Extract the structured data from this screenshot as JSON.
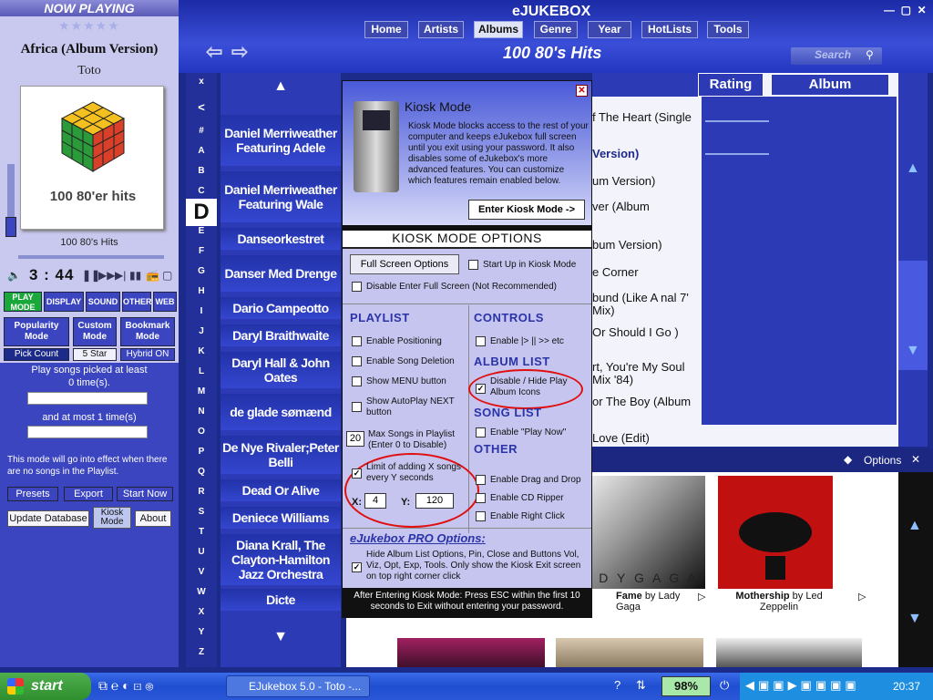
{
  "app": {
    "title": "eJUKEBOX",
    "page_title": "100 80's Hits",
    "search_placeholder": "Search"
  },
  "nav_tabs": [
    "Home",
    "Artists",
    "Albums",
    "Genre",
    "Year",
    "HotLists",
    "Tools"
  ],
  "now_playing": {
    "header": "NOW PLAYING",
    "title": "Africa (Album Version)",
    "artist": "Toto",
    "album": "100 80's Hits",
    "cover_text": "100 80'er hits",
    "time": "3 : 44"
  },
  "modes": {
    "row1": [
      "PLAY MODE",
      "DISPLAY",
      "SOUND",
      "OTHER",
      "WEB"
    ],
    "row2": [
      "Popularity Mode",
      "Custom Mode",
      "Bookmark Mode"
    ],
    "row3": [
      "Pick Count",
      "5 Star",
      "Hybrid ON"
    ]
  },
  "play_rules": {
    "line1": "Play songs picked at least",
    "line2": "0 time(s).",
    "line3": "and at most 1 time(s)",
    "note": "This mode will go into effect when there are no songs in the Playlist."
  },
  "left_buttons": {
    "presets": "Presets",
    "export": "Export",
    "start_now": "Start Now",
    "update_db": "Update Database",
    "kiosk": "Kiosk Mode",
    "about": "About"
  },
  "letters": [
    "x",
    "<",
    "#",
    "A",
    "B",
    "C",
    "D",
    "E",
    "F",
    "G",
    "H",
    "I",
    "J",
    "K",
    "L",
    "M",
    "N",
    "O",
    "P",
    "Q",
    "R",
    "S",
    "T",
    "U",
    "V",
    "W",
    "X",
    "Y",
    "Z"
  ],
  "artists": [
    "Daniel Merriweather Featuring Adele",
    "Daniel Merriweather Featuring Wale",
    "Danseorkestret",
    "Danser Med Drenge",
    "Dario Campeotto",
    "Daryl Braithwaite",
    "Daryl Hall & John Oates",
    "de glade sømænd",
    "De Nye Rivaler;Peter Belli",
    "Dead Or Alive",
    "Deniece Williams",
    "Diana Krall, The Clayton-Hamilton Jazz Orchestra",
    "Dicte"
  ],
  "columns": {
    "rating": "Rating",
    "album": "Album"
  },
  "songs": [
    "f The Heart (Single",
    "Version)",
    "um Version)",
    "ver (Album",
    "bum Version)",
    "e Corner",
    "bund (Like A nal 7' Mix)",
    "Or Should I Go )",
    "rt, You're My Soul Mix '84)",
    "or The Boy (Album",
    "Love (Edit)"
  ],
  "options_label": "Options",
  "albums": [
    {
      "title": "Fame",
      "by": "by Lady Gaga"
    },
    {
      "title": "Mothership",
      "by": "by Led Zeppelin"
    }
  ],
  "kiosk": {
    "title": "Kiosk Mode",
    "description": "Kiosk Mode blocks access to the rest of your computer and keeps eJukebox full screen until you exit using your password. It also disables some of eJukebox's more advanced features. You can customize which features remain enabled below.",
    "enter": "Enter Kiosk Mode ->",
    "options_title": "KIOSK MODE OPTIONS",
    "full_screen": "Full Screen Options",
    "start_up": "Start Up in Kiosk Mode",
    "disable_fs": "Disable Enter Full Screen (Not Recommended)",
    "playlist": "PLAYLIST",
    "controls": "CONTROLS",
    "album_list": "ALBUM LIST",
    "song_list": "SONG LIST",
    "other": "OTHER",
    "enable_positioning": "Enable Positioning",
    "enable_song_deletion": "Enable Song Deletion",
    "show_menu": "Show MENU button",
    "show_autoplay": "Show AutoPlay NEXT button",
    "max_songs_value": "20",
    "max_songs": "Max Songs in Playlist (Enter 0 to Disable)",
    "limit_label": "Limit of adding X songs every Y seconds",
    "x_label": "X:",
    "x_value": "4",
    "y_label": "Y:",
    "y_value": "120",
    "enable_controls": "Enable |> || >> etc",
    "disable_hide": "Disable / Hide Play Album Icons",
    "enable_play_now": "Enable \"Play Now\"",
    "enable_dnd": "Enable Drag and Drop",
    "enable_cd": "Enable CD Ripper",
    "enable_right": "Enable Right Click",
    "pro_title": "eJukebox PRO Options:",
    "pro_text": "Hide Album List Options, Pin, Close and Buttons Vol, Viz, Opt, Exp, Tools. Only show the Kiosk Exit screen on top right corner click",
    "footer": "After Entering Kiosk Mode: Press ESC within the first 10 seconds to Exit without entering your password."
  },
  "taskbar": {
    "start": "start",
    "task": "EJukebox 5.0 - Toto -...",
    "battery": "98%",
    "clock": "20:37"
  }
}
